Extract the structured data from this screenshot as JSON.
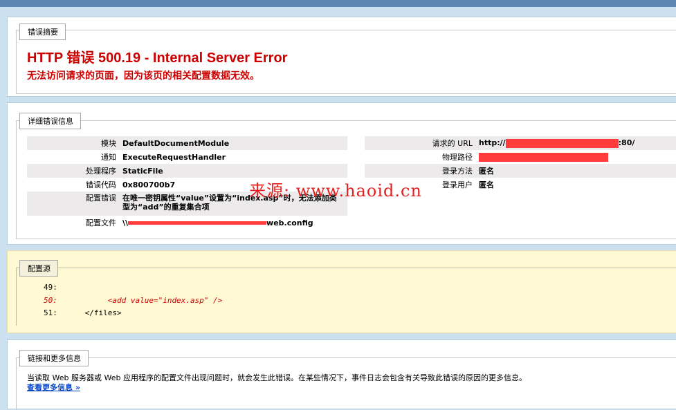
{
  "summary": {
    "legend": "错误摘要",
    "title": "HTTP 错误 500.19 - Internal Server Error",
    "subtitle": "无法访问请求的页面，因为该页的相关配置数据无效。"
  },
  "details": {
    "legend": "详细错误信息",
    "left": [
      {
        "key": "模块",
        "value": "DefaultDocumentModule"
      },
      {
        "key": "通知",
        "value": "ExecuteRequestHandler"
      },
      {
        "key": "处理程序",
        "value": "StaticFile"
      },
      {
        "key": "错误代码",
        "value": "0x800700b7"
      },
      {
        "key": "配置错误",
        "value": "在唯一密钥属性“value”设置为“index.asp”时，无法添加类型为“add”的重复集合项"
      },
      {
        "key": "配置文件",
        "value_prefix": "\\\\",
        "value_suffix": "web.config"
      }
    ],
    "right": [
      {
        "key": "请求的 URL",
        "value_prefix": "http://",
        "value_suffix": ":80/"
      },
      {
        "key": "物理路径",
        "value": ""
      },
      {
        "key": "登录方法",
        "value": "匿名"
      },
      {
        "key": "登录用户",
        "value": "匿名"
      }
    ]
  },
  "config_source": {
    "legend": "配置源",
    "lines": [
      {
        "num": "49:",
        "code": ""
      },
      {
        "num": "50:",
        "code": "           <add value=\"index.asp\" />"
      },
      {
        "num": "51:",
        "code": "      </files>"
      }
    ]
  },
  "more_info": {
    "legend": "链接和更多信息",
    "text": "当读取 Web 服务器或 Web 应用程序的配置文件出现问题时，就会发生此错误。在某些情况下，事件日志会包含有关导致此错误的原因的更多信息。",
    "link": "查看更多信息 »"
  },
  "watermark": "来源: www.haoid.cn",
  "colors": {
    "error_red": "#CC0000",
    "redaction": "#FF3B3B",
    "page_bg": "#CBE1EF",
    "config_bg": "#FFF9D4",
    "link": "#0645C8"
  }
}
